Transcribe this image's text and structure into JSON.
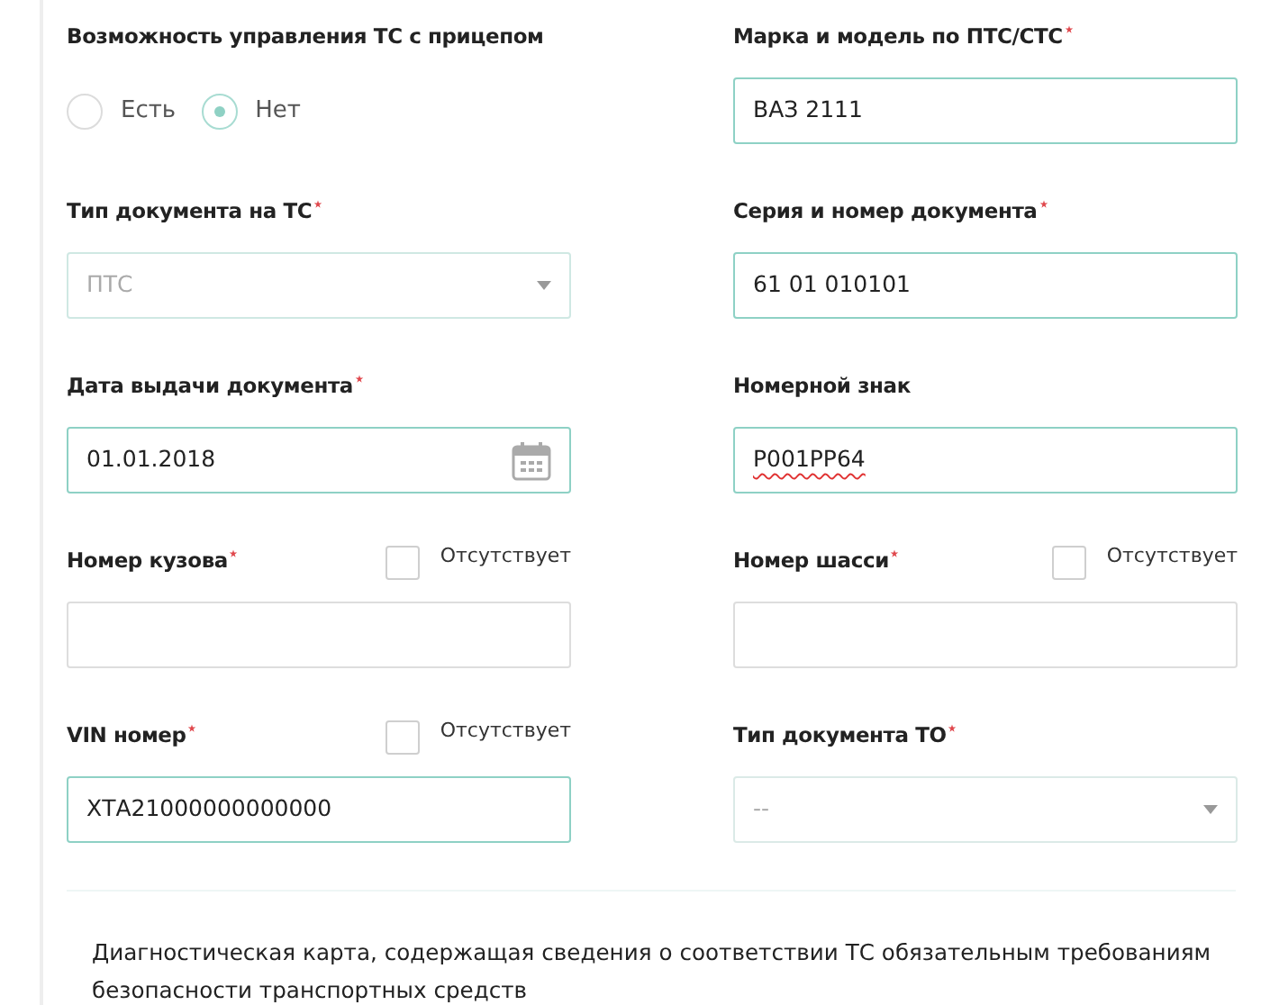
{
  "fields": [
    {
      "kind": "radio",
      "label": "Возможность управления ТС с прицепом",
      "required": false,
      "options": [
        {
          "label": "Есть",
          "selected": false
        },
        {
          "label": "Нет",
          "selected": true
        }
      ]
    },
    {
      "kind": "input",
      "label": "Марка и модель по ПТС/СТС",
      "required": true,
      "value": "ВАЗ 2111"
    },
    {
      "kind": "select",
      "label": "Тип документа на ТС",
      "required": true,
      "value": "ПТС",
      "disabled": true
    },
    {
      "kind": "input",
      "label": "Серия и номер документа",
      "required": true,
      "value": "61 01 010101"
    },
    {
      "kind": "date",
      "label": "Дата выдачи документа",
      "required": true,
      "value": "01.01.2018"
    },
    {
      "kind": "input",
      "label": "Номерной знак",
      "required": false,
      "value": "Р001РР64",
      "spellcheck_error": true
    },
    {
      "kind": "input",
      "label": "Номер кузова",
      "required": true,
      "absent": {
        "label": "Отсутствует",
        "checked": false
      }
    },
    {
      "kind": "input",
      "label": "Номер шасси",
      "required": true,
      "absent": {
        "label": "Отсутствует",
        "checked": false
      }
    },
    {
      "kind": "input",
      "label": "VIN номер",
      "required": true,
      "value": "ХТА21000000000000",
      "absent": {
        "label": "Отсутствует",
        "checked": false
      }
    },
    {
      "kind": "select",
      "label": "Тип документа ТО",
      "required": true,
      "placeholder": "--",
      "disabled": false
    }
  ],
  "note": "Диагностическая карта, содержащая сведения о соответствии ТС обязательным требованиям безопасности транспортных средств"
}
